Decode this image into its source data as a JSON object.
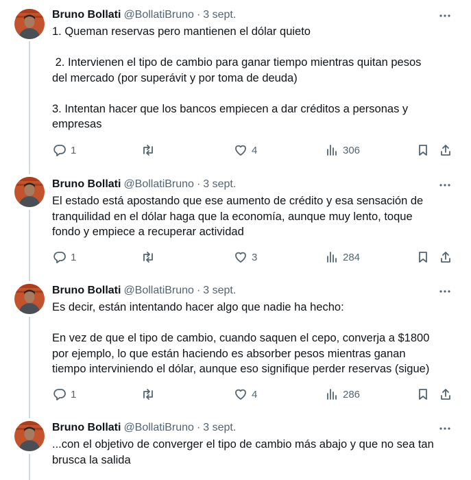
{
  "tweets": [
    {
      "name": "Bruno Bollati",
      "handle": "@BollatiBruno",
      "separator": "·",
      "date": "3 sept.",
      "text": "1. Queman reservas pero mantienen el dólar quieto\n\n 2. Intervienen el tipo de cambio para ganar tiempo mientras quitan pesos\ndel mercado (por superávit y por toma de deuda)\n\n3. Intentan hacer que los bancos empiecen a dar créditos a personas y\nempresas",
      "replies": "1",
      "retweets": "",
      "likes": "4",
      "views": "306"
    },
    {
      "name": "Bruno Bollati",
      "handle": "@BollatiBruno",
      "separator": "·",
      "date": "3 sept.",
      "text": "El estado está apostando que ese aumento de crédito y esa sensación de\ntranquilidad en el dólar haga que la economía, aunque muy lento, toque\nfondo y empiece a recuperar actividad",
      "replies": "1",
      "retweets": "",
      "likes": "3",
      "views": "284"
    },
    {
      "name": "Bruno Bollati",
      "handle": "@BollatiBruno",
      "separator": "·",
      "date": "3 sept.",
      "text": "Es decir, están intentando hacer algo que nadie ha hecho:\n\nEn vez de que el tipo de cambio, cuando saquen el cepo, converja a $1800\npor ejemplo, lo que están haciendo es absorber pesos mientras ganan\ntiempo interviniendo el dólar, aunque eso signifique perder reservas (sigue)",
      "replies": "1",
      "retweets": "",
      "likes": "4",
      "views": "286"
    },
    {
      "name": "Bruno Bollati",
      "handle": "@BollatiBruno",
      "separator": "·",
      "date": "3 sept.",
      "text": "...con el objetivo de converger el tipo de cambio más abajo y que no sea tan\nbrusca la salida"
    }
  ],
  "icons": {
    "more": "more-horizontal-icon",
    "reply": "reply-icon",
    "retweet": "retweet-icon",
    "like": "heart-icon",
    "views": "views-icon",
    "bookmark": "bookmark-icon",
    "share": "share-icon"
  },
  "colors": {
    "text": "#0f1419",
    "secondary": "#536471",
    "thread_line": "#cfd9de"
  }
}
